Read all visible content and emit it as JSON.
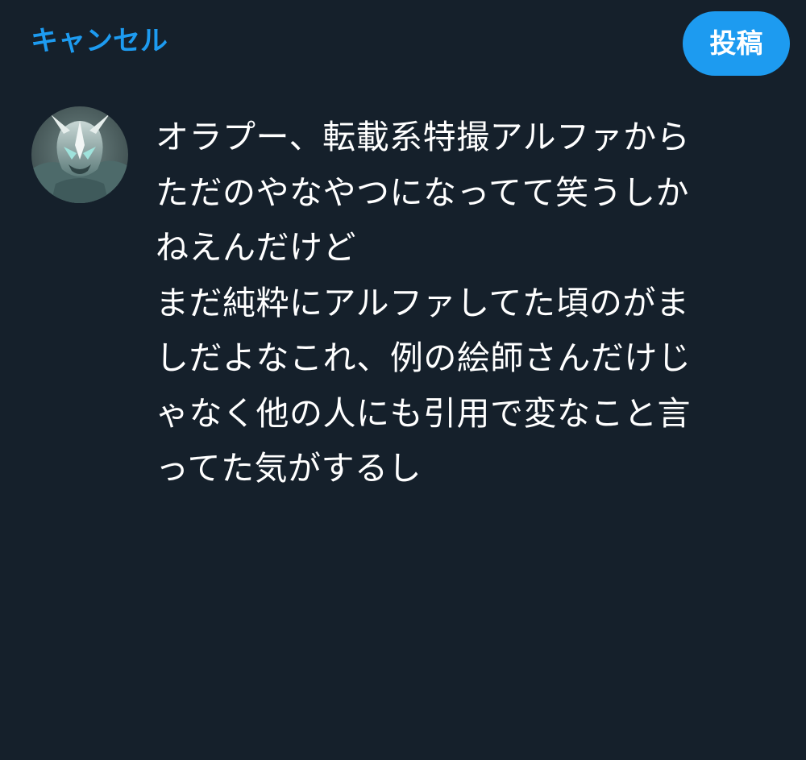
{
  "header": {
    "cancel_label": "キャンセル",
    "post_label": "投稿"
  },
  "compose": {
    "avatar_icon": "profile-avatar",
    "text_lines": [
      "オラプー、転載系特撮アルファから",
      "ただのやなやつになってて笑うしか",
      "ねえんだけど",
      "まだ純粋にアルファしてた頃のがま",
      "しだよなこれ、例の絵師さんだけじ",
      "ゃなく他の人にも引用で変なこと言",
      "ってた気がするし"
    ]
  },
  "colors": {
    "background": "#15202b",
    "accent": "#1d9bf0",
    "text": "#ffffff"
  }
}
